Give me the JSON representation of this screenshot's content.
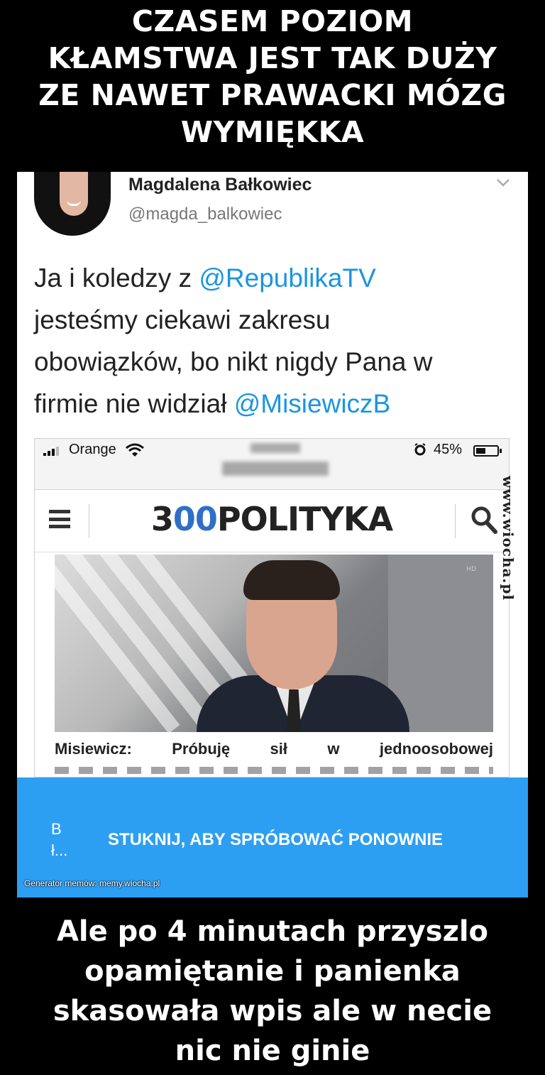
{
  "caption_top": {
    "line1": "CZASEM POZIOM",
    "line2": "KŁAMSTWA JEST TAK DUŻY",
    "line3": "ZE NAWET PRAWACKI MÓZG",
    "line4": "WYMIĘKKA"
  },
  "tweet": {
    "author_name": "Magdalena Bałkowiec",
    "author_handle": "@magda_balkowiec",
    "text": {
      "l1_a": "Ja i koledzy z ",
      "l1_mention": "@RepublikaTV",
      "l2": "jesteśmy ciekawi zakresu",
      "l3": "obowiązków, bo nikt nigdy Pana w",
      "l4_a": "firmie nie widział ",
      "l4_mention": "@MisiewiczB"
    },
    "mention_color": "#1b95e0"
  },
  "screenshot": {
    "carrier": "Orange",
    "battery_percent": "45%",
    "battery_level": 0.45,
    "site_logo_a": "3",
    "site_logo_zeros": "00",
    "site_logo_b": "POLITYKA",
    "logo_accent_color": "#2f6fc7",
    "headline": "Misiewicz:   Próbuję   sił   w   jednoosobowej"
  },
  "banner": {
    "side_line1": "B",
    "side_line2": "ł...",
    "retry_label": "STUKNIJ, ABY SPRÓBOWAĆ PONOWNIE",
    "generator": "Generator memów:  memy.wiocha.pl",
    "color": "#2d9ff3"
  },
  "watermark": "www.wiocha.pl",
  "caption_bottom": {
    "line1": "Ale po 4 minutach przyszlo",
    "line2": "opamiętanie i panienka",
    "line3": "skasowała wpis ale w necie",
    "line4": "nic nie ginie"
  }
}
